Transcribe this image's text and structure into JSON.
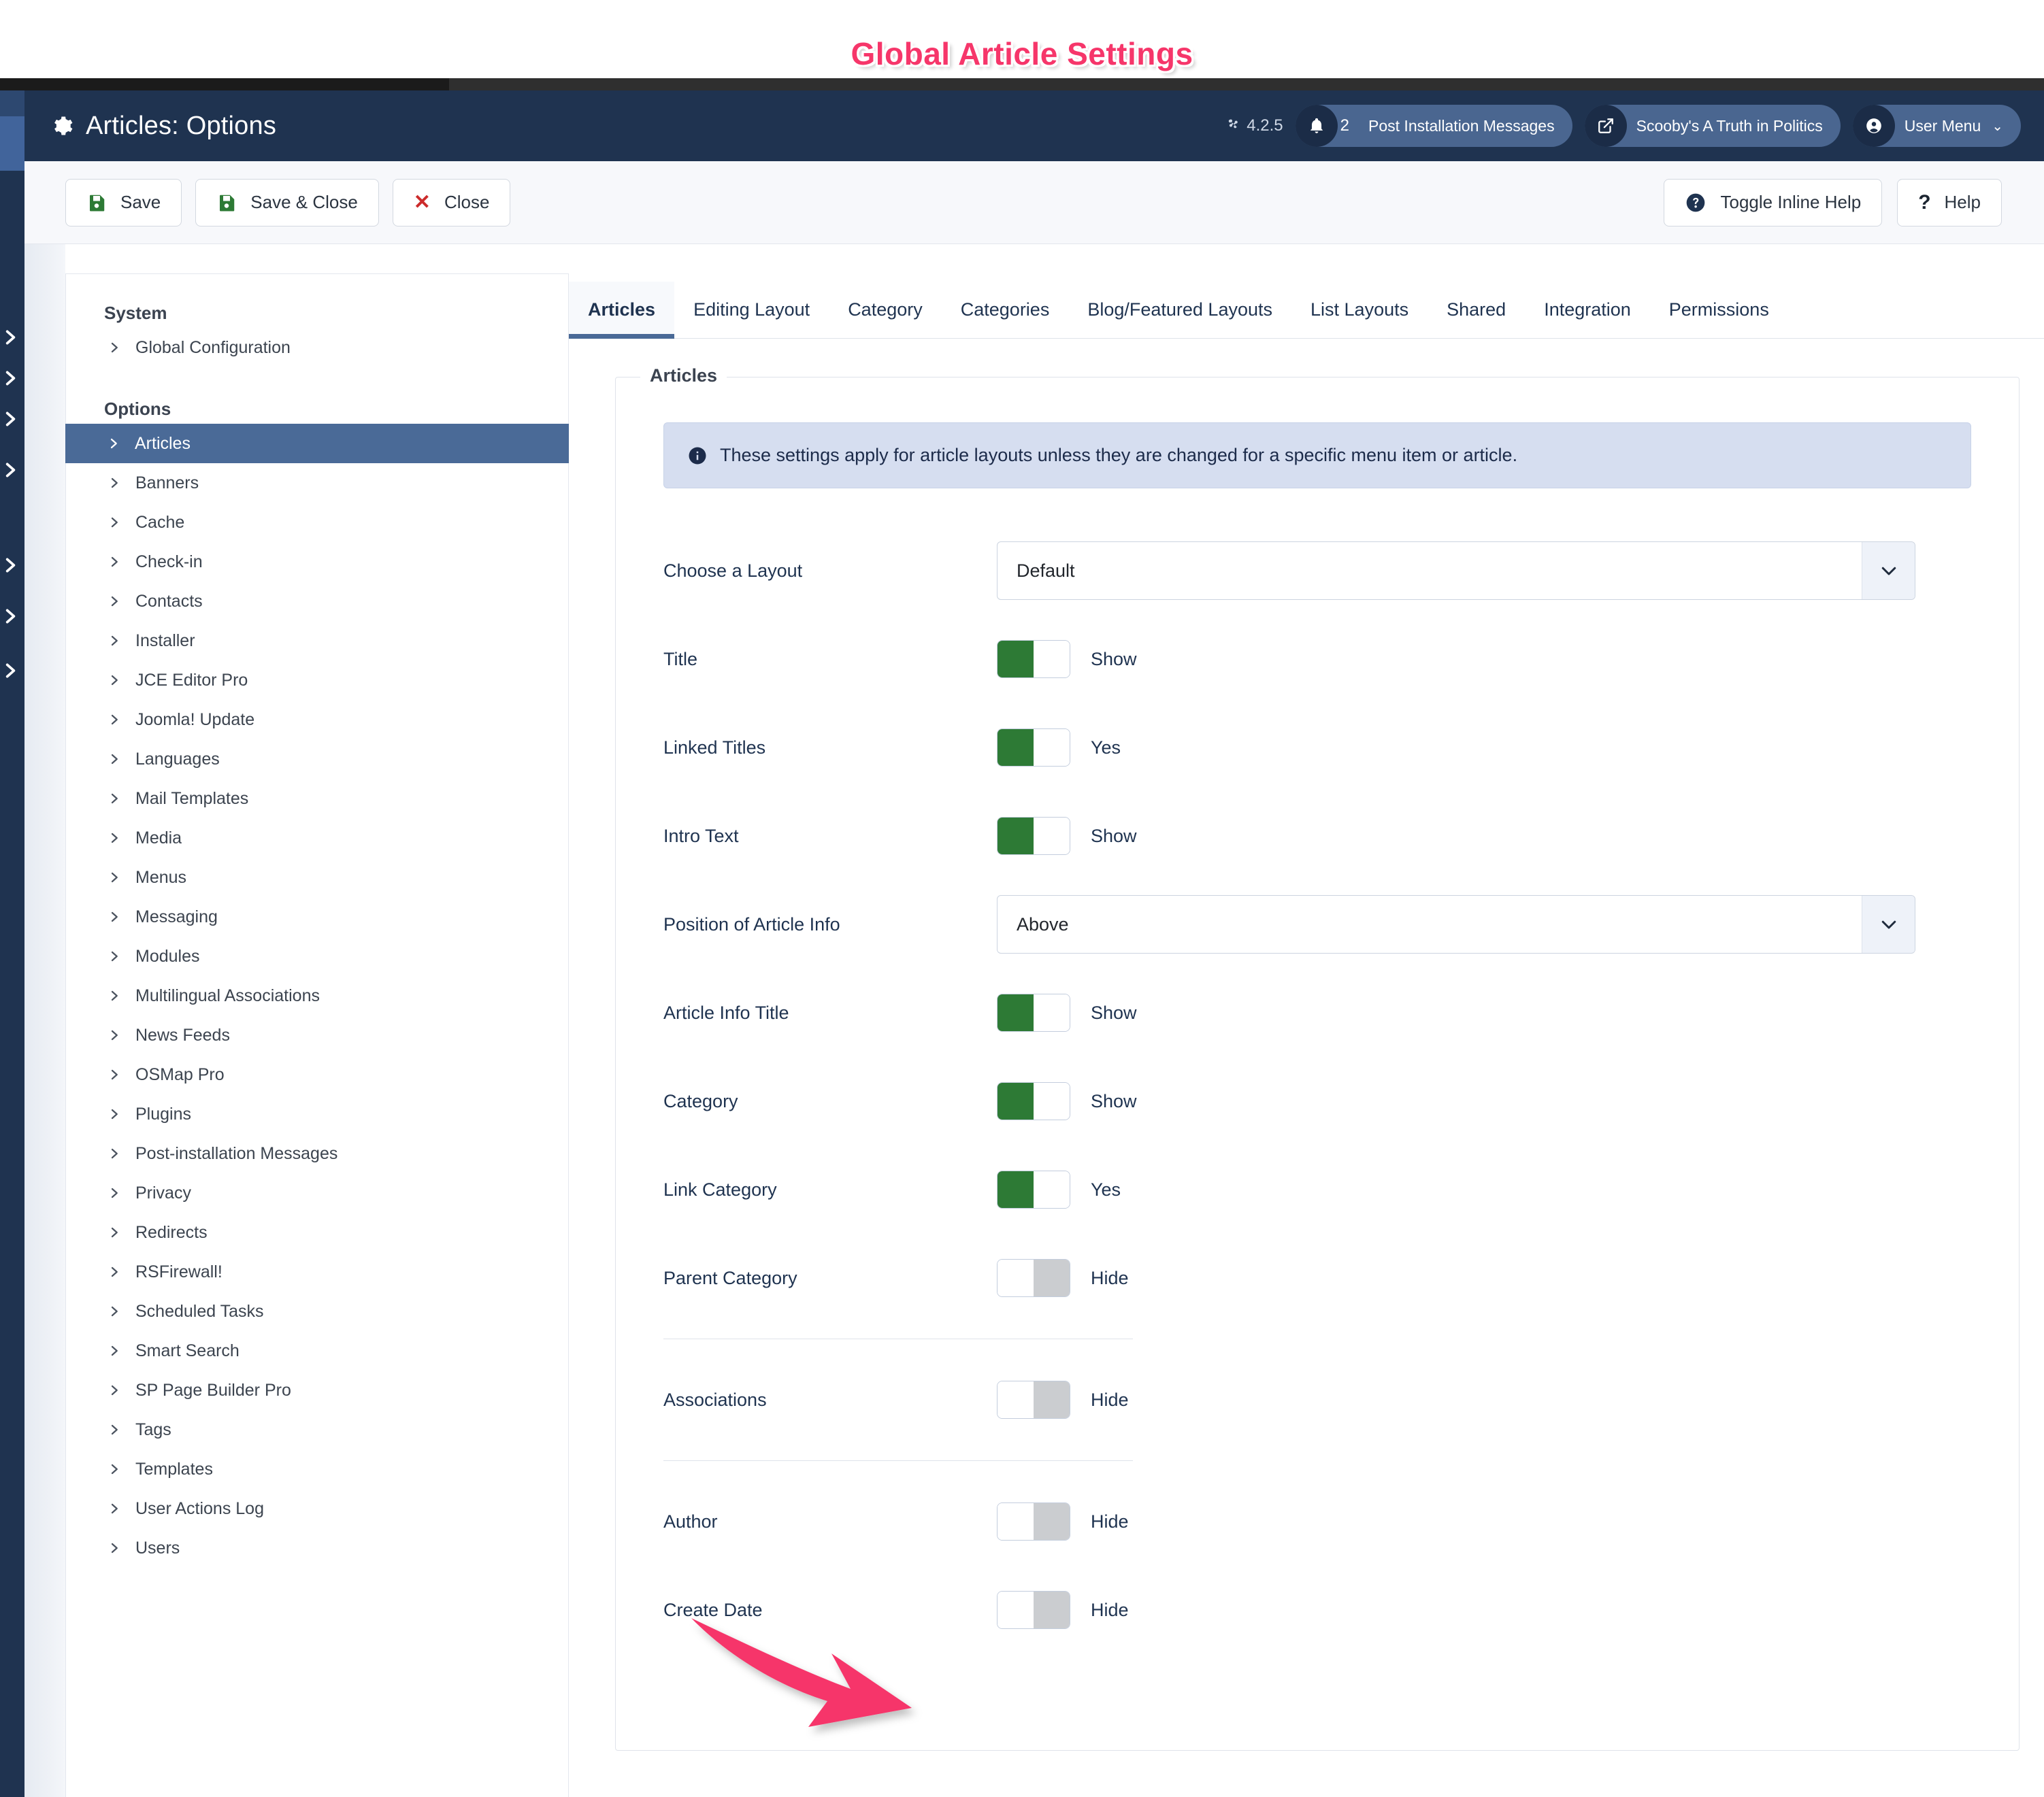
{
  "annotation": {
    "title": "Global Article Settings",
    "title_color": "#f6366a",
    "arrow_color": "#f6366a",
    "arrow_points_to": "author-toggle"
  },
  "header": {
    "page_title": "Articles: Options",
    "gear_icon": "gear-icon",
    "joomla_version": "4.2.5",
    "joomla_icon": "joomla-logo-icon",
    "messages_pill": {
      "icon": "bell-icon",
      "count": "2",
      "label": "Post Installation Messages"
    },
    "site_pill": {
      "icon": "external-link-icon",
      "label": "Scooby's A Truth in Politics"
    },
    "user_pill": {
      "icon": "user-circle-icon",
      "label": "User Menu",
      "caret": "⌄"
    }
  },
  "toolbar": {
    "save_label": "Save",
    "save_close_label": "Save & Close",
    "close_label": "Close",
    "toggle_inline_help_label": "Toggle Inline Help",
    "help_label": "Help"
  },
  "sidebar": {
    "group_system_heading": "System",
    "system_items": [
      {
        "label": "Global Configuration",
        "active": false
      }
    ],
    "group_options_heading": "Options",
    "option_items": [
      {
        "label": "Articles",
        "active": true
      },
      {
        "label": "Banners",
        "active": false
      },
      {
        "label": "Cache",
        "active": false
      },
      {
        "label": "Check-in",
        "active": false
      },
      {
        "label": "Contacts",
        "active": false
      },
      {
        "label": "Installer",
        "active": false
      },
      {
        "label": "JCE Editor Pro",
        "active": false
      },
      {
        "label": "Joomla! Update",
        "active": false
      },
      {
        "label": "Languages",
        "active": false
      },
      {
        "label": "Mail Templates",
        "active": false
      },
      {
        "label": "Media",
        "active": false
      },
      {
        "label": "Menus",
        "active": false
      },
      {
        "label": "Messaging",
        "active": false
      },
      {
        "label": "Modules",
        "active": false
      },
      {
        "label": "Multilingual Associations",
        "active": false
      },
      {
        "label": "News Feeds",
        "active": false
      },
      {
        "label": "OSMap Pro",
        "active": false
      },
      {
        "label": "Plugins",
        "active": false
      },
      {
        "label": "Post-installation Messages",
        "active": false
      },
      {
        "label": "Privacy",
        "active": false
      },
      {
        "label": "Redirects",
        "active": false
      },
      {
        "label": "RSFirewall!",
        "active": false
      },
      {
        "label": "Scheduled Tasks",
        "active": false
      },
      {
        "label": "Smart Search",
        "active": false
      },
      {
        "label": "SP Page Builder Pro",
        "active": false
      },
      {
        "label": "Tags",
        "active": false
      },
      {
        "label": "Templates",
        "active": false
      },
      {
        "label": "User Actions Log",
        "active": false
      },
      {
        "label": "Users",
        "active": false
      }
    ]
  },
  "main": {
    "tabs": [
      {
        "label": "Articles",
        "active": true
      },
      {
        "label": "Editing Layout",
        "active": false
      },
      {
        "label": "Category",
        "active": false
      },
      {
        "label": "Categories",
        "active": false
      },
      {
        "label": "Blog/Featured Layouts",
        "active": false
      },
      {
        "label": "List Layouts",
        "active": false
      },
      {
        "label": "Shared",
        "active": false
      },
      {
        "label": "Integration",
        "active": false
      },
      {
        "label": "Permissions",
        "active": false
      }
    ],
    "fieldset_legend": "Articles",
    "info_alert": {
      "icon": "info-circle-icon",
      "text": "These settings apply for article layouts unless they are changed for a specific menu item or article."
    },
    "fields": [
      {
        "type": "select",
        "label": "Choose a Layout",
        "value": "Default"
      },
      {
        "type": "toggle",
        "label": "Title",
        "state": "on",
        "state_label": "Show"
      },
      {
        "type": "toggle",
        "label": "Linked Titles",
        "state": "on",
        "state_label": "Yes"
      },
      {
        "type": "toggle",
        "label": "Intro Text",
        "state": "on",
        "state_label": "Show"
      },
      {
        "type": "select",
        "label": "Position of Article Info",
        "value": "Above"
      },
      {
        "type": "toggle",
        "label": "Article Info Title",
        "state": "on",
        "state_label": "Show"
      },
      {
        "type": "toggle",
        "label": "Category",
        "state": "on",
        "state_label": "Show"
      },
      {
        "type": "toggle",
        "label": "Link Category",
        "state": "on",
        "state_label": "Yes"
      },
      {
        "type": "toggle",
        "label": "Parent Category",
        "state": "off",
        "state_label": "Hide"
      },
      {
        "type": "divider"
      },
      {
        "type": "toggle",
        "label": "Associations",
        "state": "off",
        "state_label": "Hide"
      },
      {
        "type": "divider"
      },
      {
        "type": "toggle",
        "label": "Author",
        "state": "off",
        "state_label": "Hide"
      },
      {
        "type": "toggle",
        "label": "Create Date",
        "state": "off",
        "state_label": "Hide"
      }
    ]
  },
  "colors": {
    "header_bg": "#1f3350",
    "accent_blue": "#4a6a97",
    "toggle_on": "#2d7a35",
    "toggle_off": "#cbcdd0",
    "alert_bg": "#d6def0",
    "annotation_pink": "#f6366a"
  }
}
